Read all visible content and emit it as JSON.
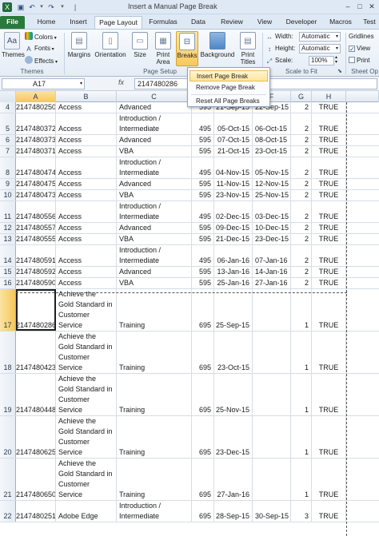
{
  "title_bar": {
    "title": "Insert a Manual Page Break"
  },
  "tabs": [
    "File",
    "Home",
    "Insert",
    "Page Layout",
    "Formulas",
    "Data",
    "Review",
    "View",
    "Developer",
    "Macros",
    "Test"
  ],
  "active_tab": "Page Layout",
  "ribbon": {
    "themes": {
      "big_label": "Themes",
      "colors": "Colors",
      "fonts": "Fonts",
      "effects": "Effects",
      "group": "Themes"
    },
    "page_setup": {
      "margins": "Margins",
      "orientation": "Orientation",
      "size": "Size",
      "print_area": "Print Area",
      "breaks": "Breaks",
      "background": "Background",
      "print_titles": "Print Titles",
      "group": "Page Setup"
    },
    "scale_to_fit": {
      "width_label": "Width:",
      "width_value": "Automatic",
      "height_label": "Height:",
      "height_value": "Automatic",
      "scale_label": "Scale:",
      "scale_value": "100%",
      "group": "Scale to Fit"
    },
    "sheet_options": {
      "gridlines": "Gridlines",
      "view": "View",
      "print": "Print",
      "group": "Sheet Op"
    }
  },
  "formula_bar": {
    "name_box": "A17",
    "fx": "fx",
    "value": "2147480286"
  },
  "breaks_menu": [
    "Insert Page Break",
    "Remove Page Break",
    "Reset All Page Breaks"
  ],
  "columns": [
    "A",
    "B",
    "C",
    "D",
    "E",
    "F",
    "G",
    "H"
  ],
  "rows": [
    {
      "n": "4",
      "a": "2147480250",
      "b": [
        "Access"
      ],
      "c": [
        "Advanced"
      ],
      "d": "595",
      "e": "21-Sep-15",
      "f": "22-Sep-15",
      "g": "2",
      "h": "TRUE"
    },
    {
      "n": "5",
      "a": "2147480372",
      "b": [
        "Access"
      ],
      "c": [
        "Introduction /",
        "Intermediate"
      ],
      "d": "495",
      "e": "05-Oct-15",
      "f": "06-Oct-15",
      "g": "2",
      "h": "TRUE"
    },
    {
      "n": "6",
      "a": "2147480373",
      "b": [
        "Access"
      ],
      "c": [
        "Advanced"
      ],
      "d": "595",
      "e": "07-Oct-15",
      "f": "08-Oct-15",
      "g": "2",
      "h": "TRUE"
    },
    {
      "n": "7",
      "a": "2147480371",
      "b": [
        "Access"
      ],
      "c": [
        "VBA"
      ],
      "d": "595",
      "e": "21-Oct-15",
      "f": "23-Oct-15",
      "g": "2",
      "h": "TRUE"
    },
    {
      "n": "8",
      "a": "2147480474",
      "b": [
        "Access"
      ],
      "c": [
        "Introduction /",
        "Intermediate"
      ],
      "d": "495",
      "e": "04-Nov-15",
      "f": "05-Nov-15",
      "g": "2",
      "h": "TRUE"
    },
    {
      "n": "9",
      "a": "2147480475",
      "b": [
        "Access"
      ],
      "c": [
        "Advanced"
      ],
      "d": "595",
      "e": "11-Nov-15",
      "f": "12-Nov-15",
      "g": "2",
      "h": "TRUE"
    },
    {
      "n": "10",
      "a": "2147480473",
      "b": [
        "Access"
      ],
      "c": [
        "VBA"
      ],
      "d": "595",
      "e": "23-Nov-15",
      "f": "25-Nov-15",
      "g": "2",
      "h": "TRUE"
    },
    {
      "n": "11",
      "a": "2147480556",
      "b": [
        "Access"
      ],
      "c": [
        "Introduction /",
        "Intermediate"
      ],
      "d": "495",
      "e": "02-Dec-15",
      "f": "03-Dec-15",
      "g": "2",
      "h": "TRUE"
    },
    {
      "n": "12",
      "a": "2147480557",
      "b": [
        "Access"
      ],
      "c": [
        "Advanced"
      ],
      "d": "595",
      "e": "09-Dec-15",
      "f": "10-Dec-15",
      "g": "2",
      "h": "TRUE"
    },
    {
      "n": "13",
      "a": "2147480555",
      "b": [
        "Access"
      ],
      "c": [
        "VBA"
      ],
      "d": "595",
      "e": "21-Dec-15",
      "f": "23-Dec-15",
      "g": "2",
      "h": "TRUE"
    },
    {
      "n": "14",
      "a": "2147480591",
      "b": [
        "Access"
      ],
      "c": [
        "Introduction /",
        "Intermediate"
      ],
      "d": "495",
      "e": "06-Jan-16",
      "f": "07-Jan-16",
      "g": "2",
      "h": "TRUE"
    },
    {
      "n": "15",
      "a": "2147480592",
      "b": [
        "Access"
      ],
      "c": [
        "Advanced"
      ],
      "d": "595",
      "e": "13-Jan-16",
      "f": "14-Jan-16",
      "g": "2",
      "h": "TRUE"
    },
    {
      "n": "16",
      "a": "2147480590",
      "b": [
        "Access"
      ],
      "c": [
        "VBA"
      ],
      "d": "595",
      "e": "25-Jan-16",
      "f": "27-Jan-16",
      "g": "2",
      "h": "TRUE"
    },
    {
      "n": "17",
      "a": "2147480286",
      "b": [
        "Achieve the",
        "Gold Standard in",
        "Customer",
        "Service"
      ],
      "c": [
        "Training"
      ],
      "d": "695",
      "e": "25-Sep-15",
      "f": "",
      "g": "1",
      "h": "TRUE"
    },
    {
      "n": "18",
      "a": "2147480423",
      "b": [
        "Achieve the",
        "Gold Standard in",
        "Customer",
        "Service"
      ],
      "c": [
        "Training"
      ],
      "d": "695",
      "e": "23-Oct-15",
      "f": "",
      "g": "1",
      "h": "TRUE"
    },
    {
      "n": "19",
      "a": "2147480448",
      "b": [
        "Achieve the",
        "Gold Standard in",
        "Customer",
        "Service"
      ],
      "c": [
        "Training"
      ],
      "d": "695",
      "e": "25-Nov-15",
      "f": "",
      "g": "1",
      "h": "TRUE"
    },
    {
      "n": "20",
      "a": "2147480625",
      "b": [
        "Achieve the",
        "Gold Standard in",
        "Customer",
        "Service"
      ],
      "c": [
        "Training"
      ],
      "d": "695",
      "e": "23-Dec-15",
      "f": "",
      "g": "1",
      "h": "TRUE"
    },
    {
      "n": "21",
      "a": "2147480650",
      "b": [
        "Achieve the",
        "Gold Standard in",
        "Customer",
        "Service"
      ],
      "c": [
        "Training"
      ],
      "d": "695",
      "e": "27-Jan-16",
      "f": "",
      "g": "1",
      "h": "TRUE"
    },
    {
      "n": "22",
      "a": "2147480251",
      "b": [
        "Adobe Edge"
      ],
      "c": [
        "Introduction /",
        "Intermediate"
      ],
      "d": "695",
      "e": "28-Sep-15",
      "f": "30-Sep-15",
      "g": "3",
      "h": "TRUE"
    }
  ],
  "colors": {
    "file_tab": "#2a7a3b",
    "selection": "#f4c75b",
    "ribbon_bg": "#e4ecf6"
  }
}
